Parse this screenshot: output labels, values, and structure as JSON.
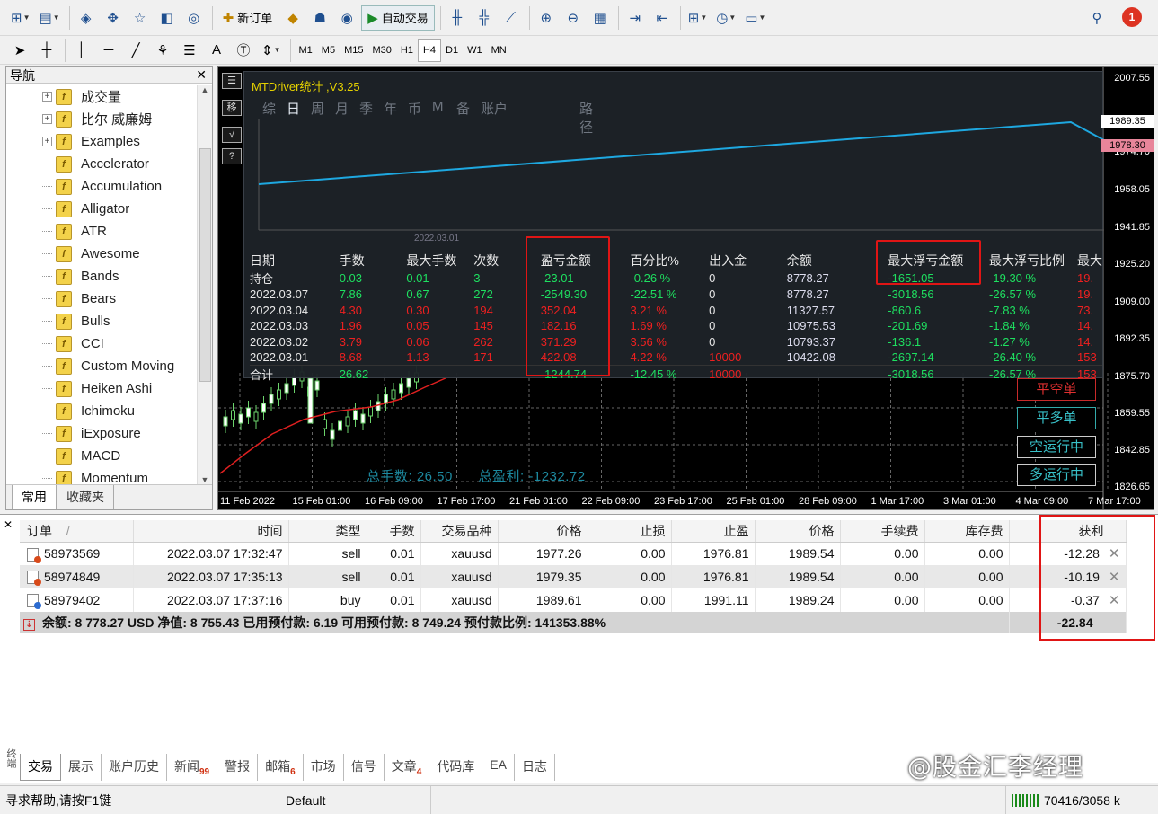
{
  "toolbar1": {
    "new_order": "新订单",
    "auto_trading": "自动交易",
    "notification_count": "1"
  },
  "toolbar2": {
    "timeframes": [
      "M1",
      "M5",
      "M15",
      "M30",
      "H1",
      "H4",
      "D1",
      "W1",
      "MN"
    ],
    "active_timeframe": "H4",
    "text_tool": "A"
  },
  "navigator": {
    "title": "导航",
    "items": [
      "成交量",
      "比尔 威廉姆",
      "Examples",
      "Accelerator",
      "Accumulation",
      "Alligator",
      "ATR",
      "Awesome",
      "Bands",
      "Bears",
      "Bulls",
      "CCI",
      "Custom Moving",
      "Heiken Ashi",
      "Ichimoku",
      "iExposure",
      "MACD",
      "Momentum"
    ],
    "tabs": [
      "常用",
      "收藏夹"
    ],
    "active_tab": "常用"
  },
  "chart": {
    "overlay_title": "MTDriver统计 ,V3.25",
    "overlay_tabs": [
      "综",
      "日",
      "周",
      "月",
      "季",
      "年",
      "币",
      "M",
      "备",
      "账户",
      "路径"
    ],
    "active_overlay_tab": "日",
    "overlay_axis_date": "2022.03.01",
    "stats_headers": [
      "日期",
      "手数",
      "最大手数",
      "次数",
      "盈亏金额",
      "百分比%",
      "出入金",
      "余额",
      "最大浮亏金额",
      "最大浮亏比例",
      "最大"
    ],
    "stats_rows": [
      {
        "date": "持仓",
        "lots": "0.03",
        "max_lots": "0.01",
        "count": "3",
        "pl": "-23.01",
        "pct": "-0.26 %",
        "io": "0",
        "balance": "8778.27",
        "max_float_loss": "-1651.05",
        "max_float_pct": "-19.30 %",
        "extra": "19.",
        "cls": "g"
      },
      {
        "date": "2022.03.07",
        "lots": "7.86",
        "max_lots": "0.67",
        "count": "272",
        "pl": "-2549.30",
        "pct": "-22.51 %",
        "io": "0",
        "balance": "8778.27",
        "max_float_loss": "-3018.56",
        "max_float_pct": "-26.57 %",
        "extra": "19.",
        "cls": "g"
      },
      {
        "date": "2022.03.04",
        "lots": "4.30",
        "max_lots": "0.30",
        "count": "194",
        "pl": "352.04",
        "pct": "3.21 %",
        "io": "0",
        "balance": "11327.57",
        "max_float_loss": "-860.6",
        "max_float_pct": "-7.83 %",
        "extra": "73.",
        "cls": "r"
      },
      {
        "date": "2022.03.03",
        "lots": "1.96",
        "max_lots": "0.05",
        "count": "145",
        "pl": "182.16",
        "pct": "1.69 %",
        "io": "0",
        "balance": "10975.53",
        "max_float_loss": "-201.69",
        "max_float_pct": "-1.84 %",
        "extra": "14.",
        "cls": "r"
      },
      {
        "date": "2022.03.02",
        "lots": "3.79",
        "max_lots": "0.06",
        "count": "262",
        "pl": "371.29",
        "pct": "3.56 %",
        "io": "0",
        "balance": "10793.37",
        "max_float_loss": "-136.1",
        "max_float_pct": "-1.27 %",
        "extra": "14.",
        "cls": "r"
      },
      {
        "date": "2022.03.01",
        "lots": "8.68",
        "max_lots": "1.13",
        "count": "171",
        "pl": "422.08",
        "pct": "4.22 %",
        "io": "10000",
        "balance": "10422.08",
        "max_float_loss": "-2697.14",
        "max_float_pct": "-26.40 %",
        "extra": "153",
        "cls": "r"
      }
    ],
    "stats_total": {
      "date": "合计",
      "lots": "26.62",
      "pl": "-1244.74",
      "pct": "-12.45 %",
      "io": "10000",
      "max_float_loss": "-3018.56",
      "max_float_pct": "-26.57 %",
      "extra": "153"
    },
    "buttons": {
      "close_short": "平空单",
      "close_long": "平多单",
      "run_short": "空运行中",
      "run_long": "多运行中"
    },
    "totals_line": {
      "lots": "总手数: 26.50",
      "profit": "总盈利: -1232.72"
    },
    "price_ticks": [
      "2007.55",
      "1974.70",
      "1958.05",
      "1941.85",
      "1925.20",
      "1909.00",
      "1892.35",
      "1875.70",
      "1859.55",
      "1842.85",
      "1826.65"
    ],
    "price_tags": {
      "ask": "1989.35",
      "bid": "1978.30"
    },
    "time_ticks": [
      "11 Feb 2022",
      "15 Feb 01:00",
      "16 Feb 09:00",
      "17 Feb 17:00",
      "21 Feb 01:00",
      "22 Feb 09:00",
      "23 Feb 17:00",
      "25 Feb 01:00",
      "28 Feb 09:00",
      "1 Mar 17:00",
      "3 Mar 01:00",
      "4 Mar 09:00",
      "7 Mar 17:00"
    ],
    "colors": {
      "balance_line": "#1ea8e0",
      "highlight_box": "#e01515",
      "profit_green": "#1ee060",
      "loss_red": "#ee2020"
    }
  },
  "terminal": {
    "headers": [
      "订单",
      "/",
      "时间",
      "类型",
      "手数",
      "交易品种",
      "价格",
      "止损",
      "止盈",
      "价格",
      "手续费",
      "库存费",
      "获利"
    ],
    "orders": [
      {
        "id": "58973569",
        "time": "2022.03.07 17:32:47",
        "type": "sell",
        "lots": "0.01",
        "symbol": "xauusd",
        "open_price": "1977.26",
        "sl": "0.00",
        "tp": "1976.81",
        "cur_price": "1989.54",
        "fee": "0.00",
        "swap": "0.00",
        "profit": "-12.28"
      },
      {
        "id": "58974849",
        "time": "2022.03.07 17:35:13",
        "type": "sell",
        "lots": "0.01",
        "symbol": "xauusd",
        "open_price": "1979.35",
        "sl": "0.00",
        "tp": "1976.81",
        "cur_price": "1989.54",
        "fee": "0.00",
        "swap": "0.00",
        "profit": "-10.19"
      },
      {
        "id": "58979402",
        "time": "2022.03.07 17:37:16",
        "type": "buy",
        "lots": "0.01",
        "symbol": "xauusd",
        "open_price": "1989.61",
        "sl": "0.00",
        "tp": "1991.11",
        "cur_price": "1989.24",
        "fee": "0.00",
        "swap": "0.00",
        "profit": "-0.37"
      }
    ],
    "summary": "余额: 8 778.27 USD  净值: 8 755.43  已用预付款: 6.19  可用预付款: 8 749.24  预付款比例: 141353.88%",
    "summary_profit": "-22.84",
    "tabs": [
      {
        "label": "交易",
        "badge": ""
      },
      {
        "label": "展示",
        "badge": ""
      },
      {
        "label": "账户历史",
        "badge": ""
      },
      {
        "label": "新闻",
        "badge": "99"
      },
      {
        "label": "警报",
        "badge": ""
      },
      {
        "label": "邮箱",
        "badge": "6"
      },
      {
        "label": "市场",
        "badge": ""
      },
      {
        "label": "信号",
        "badge": ""
      },
      {
        "label": "文章",
        "badge": "4"
      },
      {
        "label": "代码库",
        "badge": ""
      },
      {
        "label": "EA",
        "badge": ""
      },
      {
        "label": "日志",
        "badge": ""
      }
    ],
    "side_label": "终端"
  },
  "statusbar": {
    "help": "寻求帮助,请按F1键",
    "profile": "Default",
    "traffic": "70416/3058 k"
  },
  "watermark": "@股金汇李经理"
}
